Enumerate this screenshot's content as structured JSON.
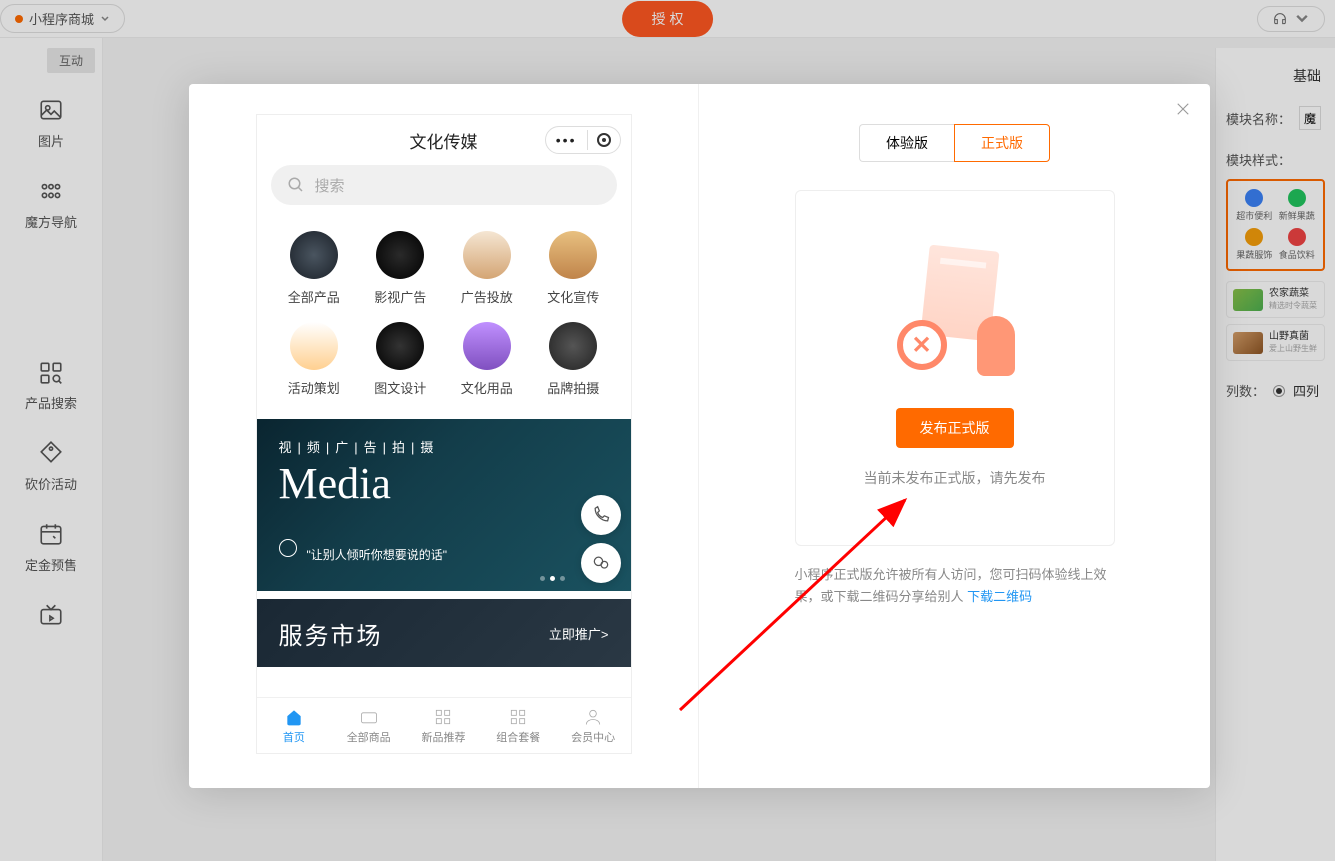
{
  "topbar": {
    "app_name": "小程序商城",
    "auth_label": "授 权"
  },
  "sidebar": {
    "tag": "互动",
    "items": [
      {
        "label": "图片"
      },
      {
        "label": "魔方导航"
      },
      {
        "label": "产品搜索"
      },
      {
        "label": "砍价活动"
      },
      {
        "label": "定金预售"
      }
    ]
  },
  "props": {
    "base_tab": "基础",
    "name_label": "模块名称：",
    "name_value": "魔方",
    "style_label": "模块样式：",
    "style_items": [
      {
        "label": "超市便利",
        "color": "#3b82f6"
      },
      {
        "label": "新鲜果蔬",
        "color": "#22c55e"
      },
      {
        "label": "果蔬服饰",
        "color": "#f59e0b"
      },
      {
        "label": "食品饮料",
        "color": "#ef4444"
      }
    ],
    "list": [
      {
        "title": "农家蔬菜",
        "sub": "精选时令蔬菜"
      },
      {
        "title": "山野真菌",
        "sub": "爱上山野生鲜"
      }
    ],
    "col_label": "列数：",
    "col_value": "四列"
  },
  "phone": {
    "title": "文化传媒",
    "search_placeholder": "搜索",
    "cats": [
      {
        "label": "全部产品"
      },
      {
        "label": "影视广告"
      },
      {
        "label": "广告投放"
      },
      {
        "label": "文化宣传"
      },
      {
        "label": "活动策划"
      },
      {
        "label": "图文设计"
      },
      {
        "label": "文化用品"
      },
      {
        "label": "品牌拍摄"
      }
    ],
    "banner": {
      "tag": "视|频|广|告|拍|摄",
      "title": "Media",
      "sub": "\"让别人倾听你想要说的话\""
    },
    "service": {
      "title": "服务市场",
      "more": "立即推广>"
    },
    "tabs": [
      {
        "label": "首页"
      },
      {
        "label": "全部商品"
      },
      {
        "label": "新品推荐"
      },
      {
        "label": "组合套餐"
      },
      {
        "label": "会员中心"
      }
    ]
  },
  "publish": {
    "tabs": [
      {
        "label": "体验版"
      },
      {
        "label": "正式版"
      }
    ],
    "btn": "发布正式版",
    "status": "当前未发布正式版，请先发布",
    "desc_prefix": "小程序正式版允许被所有人访问，您可扫码体验线上效果，或下载二维码分享给别人 ",
    "desc_link": "下载二维码"
  }
}
